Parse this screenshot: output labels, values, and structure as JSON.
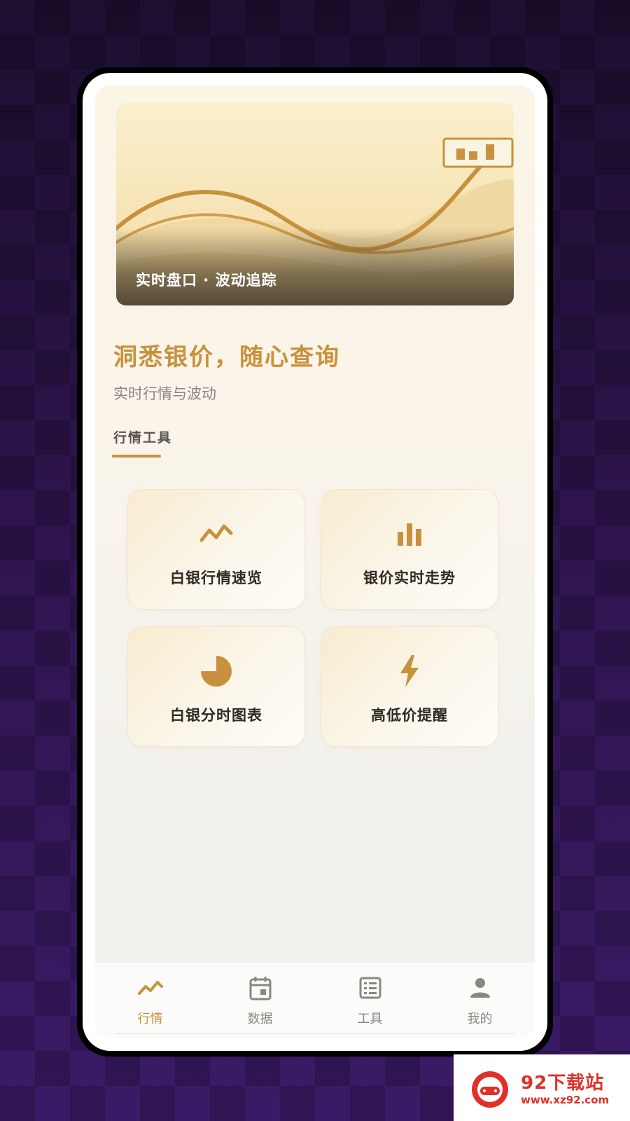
{
  "banner": {
    "caption": "实时盘口 · 波动追踪"
  },
  "hero": {
    "headline": "洞悉银价，随心查询",
    "subhead": "实时行情与波动"
  },
  "section": {
    "title": "行情工具"
  },
  "tools": [
    {
      "label": "白银行情速览",
      "icon": "line-chart-icon"
    },
    {
      "label": "银价实时走势",
      "icon": "bar-chart-icon"
    },
    {
      "label": "白银分时图表",
      "icon": "pie-chart-icon"
    },
    {
      "label": "高低价提醒",
      "icon": "lightning-icon"
    }
  ],
  "tabbar": [
    {
      "label": "行情",
      "icon": "trend-icon",
      "active": true
    },
    {
      "label": "数据",
      "icon": "calendar-icon",
      "active": false
    },
    {
      "label": "工具",
      "icon": "list-icon",
      "active": false
    },
    {
      "label": "我的",
      "icon": "user-icon",
      "active": false
    }
  ],
  "colors": {
    "accent": "#c8913d",
    "text_dark": "#2e2a26",
    "muted": "#8a8680"
  },
  "watermark": {
    "title": "92下载站",
    "url": "www.xz92.com"
  }
}
